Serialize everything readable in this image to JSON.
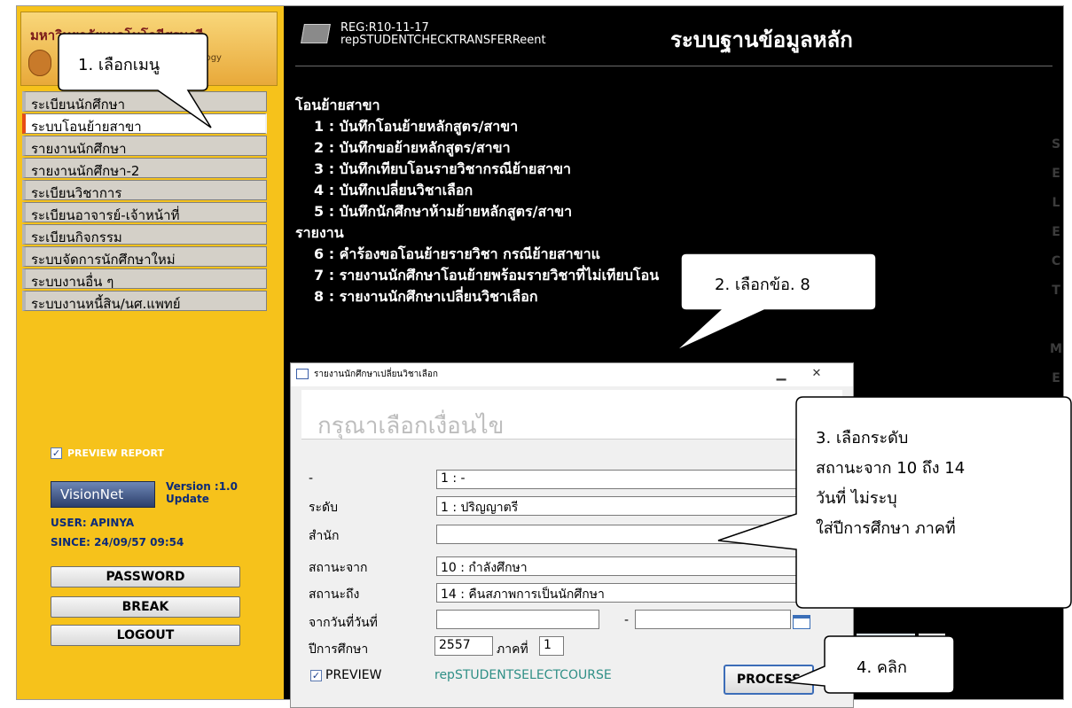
{
  "logo": {
    "title": "มหาวิทยาลัยเทคโนโลยีสุรนารี",
    "subtitle": "nnology"
  },
  "sidebar": {
    "items": [
      {
        "label": "ระเบียนนักศึกษา"
      },
      {
        "label": "ระบบโอนย้ายสาขา"
      },
      {
        "label": "รายงานนักศึกษา"
      },
      {
        "label": "รายงานนักศึกษา-2"
      },
      {
        "label": "ระเบียนวิชาการ"
      },
      {
        "label": "ระเบียนอาจารย์-เจ้าหน้าที่"
      },
      {
        "label": "ระเบียนกิจกรรม"
      },
      {
        "label": "ระบบจัดการนักศึกษาใหม่"
      },
      {
        "label": "ระบบงานอื่น ๆ"
      },
      {
        "label": "ระบบงานหนี้สิน/นศ.แพทย์"
      }
    ],
    "preview_report": "PREVIEW REPORT",
    "visionnet": "VisionNet",
    "version": "Version :1.0",
    "update": "Update",
    "user": "USER: APINYA",
    "since": "SINCE: 24/09/57 09:54",
    "buttons": {
      "password": "PASSWORD",
      "break": "BREAK",
      "logout": "LOGOUT"
    }
  },
  "header": {
    "code": "REG:R10-11-17",
    "report": "repSTUDENTCHECKTRANSFERReent",
    "title": "ระบบฐานข้อมูลหลัก"
  },
  "menu": {
    "section1": "โอนย้ายสาขา",
    "section2": "รายงาน",
    "items": [
      "1 : บันทึกโอนย้ายหลักสูตร/สาขา",
      "2 : บันทึกขอย้ายหลักสูตร/สาขา",
      "3 : บันทึกเทียบโอนรายวิชากรณีย้ายสาขา",
      "4 : บันทึกเปลี่ยนวิชาเลือก",
      "5 : บันทึกนักศึกษาห้ามย้ายหลักสูตร/สาขา",
      "6 : คำร้องขอโอนย้ายรายวิชา กรณีย้ายสาขาแ",
      "7 : รายงานนักศึกษาโอนย้ายพร้อมรายวิชาที่ไม่เทียบโอน",
      "8 : รายงานนักศึกษาเปลี่ยนวิชาเลือก"
    ],
    "vertical_text": "SELECT ME"
  },
  "dialog": {
    "title": "รายงานนักศึกษาเปลี่ยนวิชาเลือก",
    "heading": "กรุณาเลือกเงื่อนไข",
    "fields": {
      "dash_label": "-",
      "dash_value": "1 : -",
      "level_label": "ระดับ",
      "level_value": "1 : ปริญญาตรี",
      "office_label": "สำนัก",
      "office_value": "",
      "status_from_label": "สถานะจาก",
      "status_from_value": "10 : กำลังศึกษา",
      "status_to_label": "สถานะถึง",
      "status_to_value": "14 : คืนสภาพการเป็นนักศึกษา",
      "date_label": "จากวันที่วันที่",
      "date_from": "",
      "date_sep": "-",
      "date_to": "",
      "year_label": "ปีการศึกษา",
      "year_value": "2557",
      "term_label": "ภาคที่",
      "term_value": "1"
    },
    "preview_label": "PREVIEW",
    "report_name": "repSTUDENTSELECTCOURSE",
    "process_label": "PROCESS"
  },
  "callouts": {
    "c1": "1. เลือกเมนู",
    "c2": "2. เลือกข้อ. 8",
    "c3_lines": [
      "3.  เลือกระดับ",
      "สถานะจาก  10 ถึง 14",
      "วันที่  ไม่ระบุ",
      "ใส่ปีการศึกษา  ภาคที่"
    ],
    "c4": "4. คลิก"
  }
}
